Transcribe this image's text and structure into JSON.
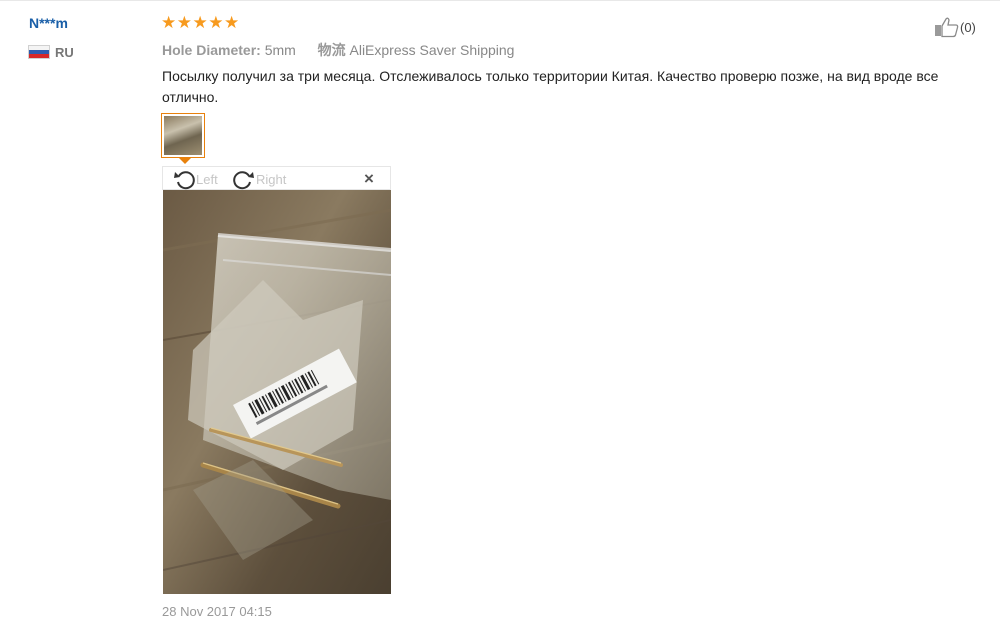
{
  "review": {
    "user_name": "N***m",
    "country_code": "RU",
    "rating_stars": 5,
    "helpful_count": "(0)",
    "attribute_label": "Hole Diameter:",
    "attribute_value": "5mm",
    "shipping_label": "物流",
    "shipping_value": "AliExpress Saver Shipping",
    "text": "Посылку получил за три месяца. Отслеживалось только территории Китая. Качество проверю позже, на вид вроде все отлично.",
    "date": "28 Nov 2017 04:15"
  },
  "viewer": {
    "rotate_left_label": "Left",
    "rotate_right_label": "Right",
    "close_label": "×"
  },
  "icons": {
    "star": "star-icon",
    "thumbs_up": "thumbs-up-icon",
    "rotate_left": "rotate-left-icon",
    "rotate_right": "rotate-right-icon",
    "close": "close-icon",
    "flag": "russia-flag-icon"
  },
  "colors": {
    "username": "#1a5fa8",
    "star": "#f79a1e",
    "thumb_border": "#e8810c"
  }
}
